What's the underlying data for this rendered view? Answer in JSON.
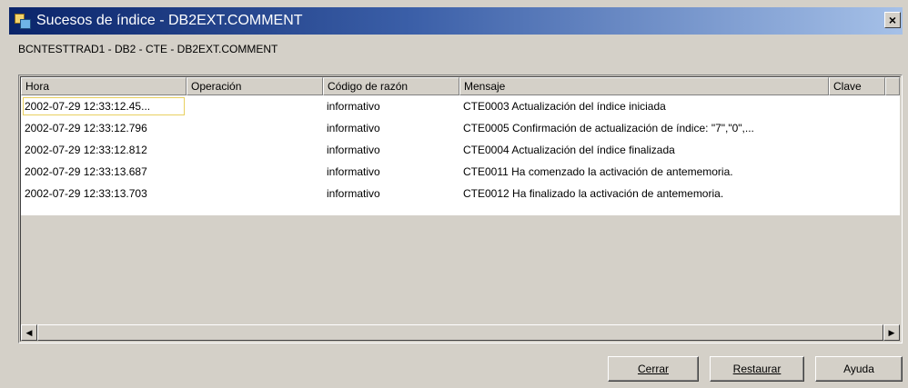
{
  "window": {
    "title": "Sucesos de índice - DB2EXT.COMMENT",
    "close_glyph": "×"
  },
  "subtitle": "BCNTESTTRAD1 - DB2 - CTE - DB2EXT.COMMENT",
  "table": {
    "columns": [
      "Hora",
      "Operación",
      "Código de razón",
      "Mensaje",
      "Clave"
    ],
    "rows": [
      {
        "hora": "2002-07-29 12:33:12.45...",
        "operacion": "",
        "codigo": "informativo",
        "mensaje": "CTE0003 Actualización del índice iniciada",
        "clave": ""
      },
      {
        "hora": "2002-07-29 12:33:12.796",
        "operacion": "",
        "codigo": "informativo",
        "mensaje": "CTE0005 Confirmación de actualización de índice: \"7\",\"0\",...",
        "clave": ""
      },
      {
        "hora": "2002-07-29 12:33:12.812",
        "operacion": "",
        "codigo": "informativo",
        "mensaje": "CTE0004 Actualización del índice finalizada",
        "clave": ""
      },
      {
        "hora": "2002-07-29 12:33:13.687",
        "operacion": "",
        "codigo": "informativo",
        "mensaje": "CTE0011 Ha comenzado la activación de antememoria.",
        "clave": ""
      },
      {
        "hora": "2002-07-29 12:33:13.703",
        "operacion": "",
        "codigo": "informativo",
        "mensaje": "CTE0012 Ha finalizado la activación de antememoria.",
        "clave": ""
      }
    ]
  },
  "scroll": {
    "left_glyph": "◀",
    "right_glyph": "▶"
  },
  "buttons": {
    "cerrar": "Cerrar",
    "restaurar": "Restaurar",
    "ayuda": "Ayuda"
  },
  "icons": {
    "window_icon": "folder-tree-icon"
  },
  "colors": {
    "titlebar_start": "#0a246a",
    "titlebar_end": "#a6c1e8",
    "dialog_bg": "#d4d0c8",
    "selection_outline": "#e8d060"
  }
}
